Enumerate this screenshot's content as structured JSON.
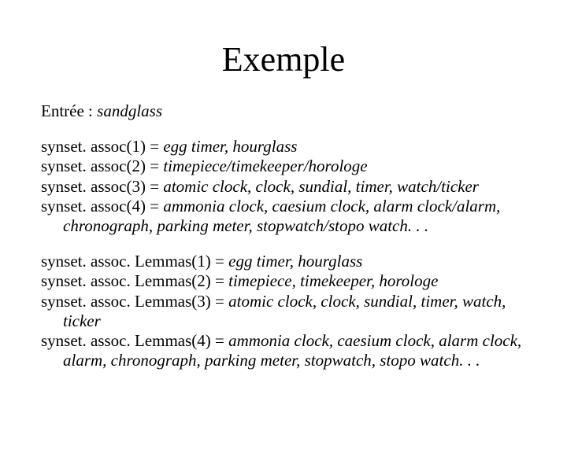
{
  "title": "Exemple",
  "entry_label": "Entrée : ",
  "entry_value": "sandglass",
  "assoc": [
    {
      "label": "synset. assoc(1) = ",
      "value": "egg timer, hourglass"
    },
    {
      "label": "synset. assoc(2) = ",
      "value": "timepiece/timekeeper/horologe"
    },
    {
      "label": "synset. assoc(3) = ",
      "value": "atomic clock, clock, sundial, timer, watch/ticker"
    },
    {
      "label": "synset. assoc(4) = ",
      "value": "ammonia clock, caesium clock, alarm clock/alarm, chronograph, parking meter, stopwatch/stopo watch. . ."
    }
  ],
  "lemmas": [
    {
      "label": "synset. assoc. Lemmas(1) = ",
      "value": "egg timer, hourglass"
    },
    {
      "label": "synset. assoc. Lemmas(2) = ",
      "value": "timepiece, timekeeper, horologe"
    },
    {
      "label": "synset. assoc. Lemmas(3) = ",
      "value": "atomic clock, clock, sundial, timer, watch, ticker"
    },
    {
      "label": "synset. assoc. Lemmas(4) = ",
      "value": "ammonia clock, caesium clock, alarm clock, alarm, chronograph, parking meter, stopwatch, stopo watch. . ."
    }
  ]
}
